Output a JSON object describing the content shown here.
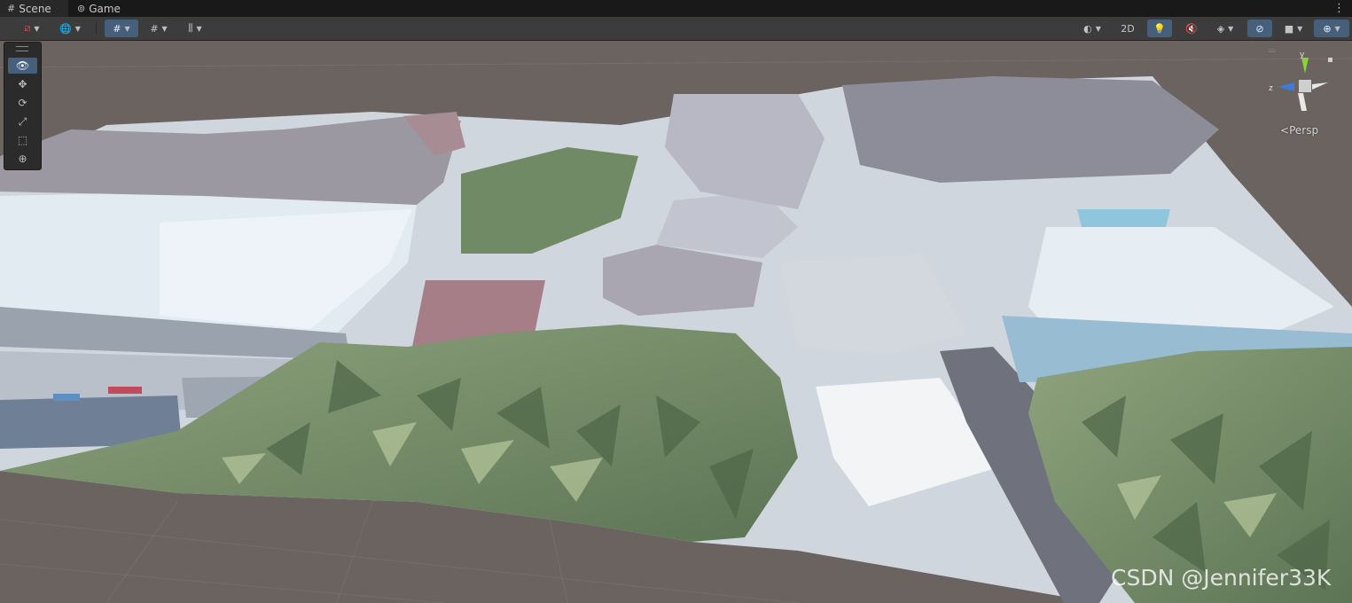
{
  "tabs": [
    {
      "label": "Scene",
      "icon": "grid-icon",
      "active": true
    },
    {
      "label": "Game",
      "icon": "gamepad-icon",
      "active": false
    }
  ],
  "toolbar": {
    "view_2d_label": "2D"
  },
  "tools": [
    {
      "name": "view-tool",
      "icon": "eye-icon",
      "glyph": "👁",
      "active": true
    },
    {
      "name": "move-tool",
      "icon": "move-arrows-icon",
      "glyph": "✥",
      "active": false
    },
    {
      "name": "rotate-tool",
      "icon": "rotate-icon",
      "glyph": "⟳",
      "active": false
    },
    {
      "name": "scale-tool",
      "icon": "scale-icon",
      "glyph": "⤢",
      "active": false
    },
    {
      "name": "rect-tool",
      "icon": "rect-transform-icon",
      "glyph": "⬚",
      "active": false
    },
    {
      "name": "transform-tool",
      "icon": "transform-icon",
      "glyph": "⊕",
      "active": false
    }
  ],
  "gizmo": {
    "y_label": "y",
    "z_label": "z",
    "projection_label": "Persp",
    "colors": {
      "y": "#8ad13a",
      "z": "#3d7be0",
      "x": "#d23b2f"
    }
  },
  "colors": {
    "ground": "#6b6360",
    "accent": "#46607c",
    "vegetation": "#7f9a6e",
    "roof_white": "#d9e2ea",
    "roof_pink": "#a47e87"
  },
  "watermark": "CSDN @Jennifer33K"
}
